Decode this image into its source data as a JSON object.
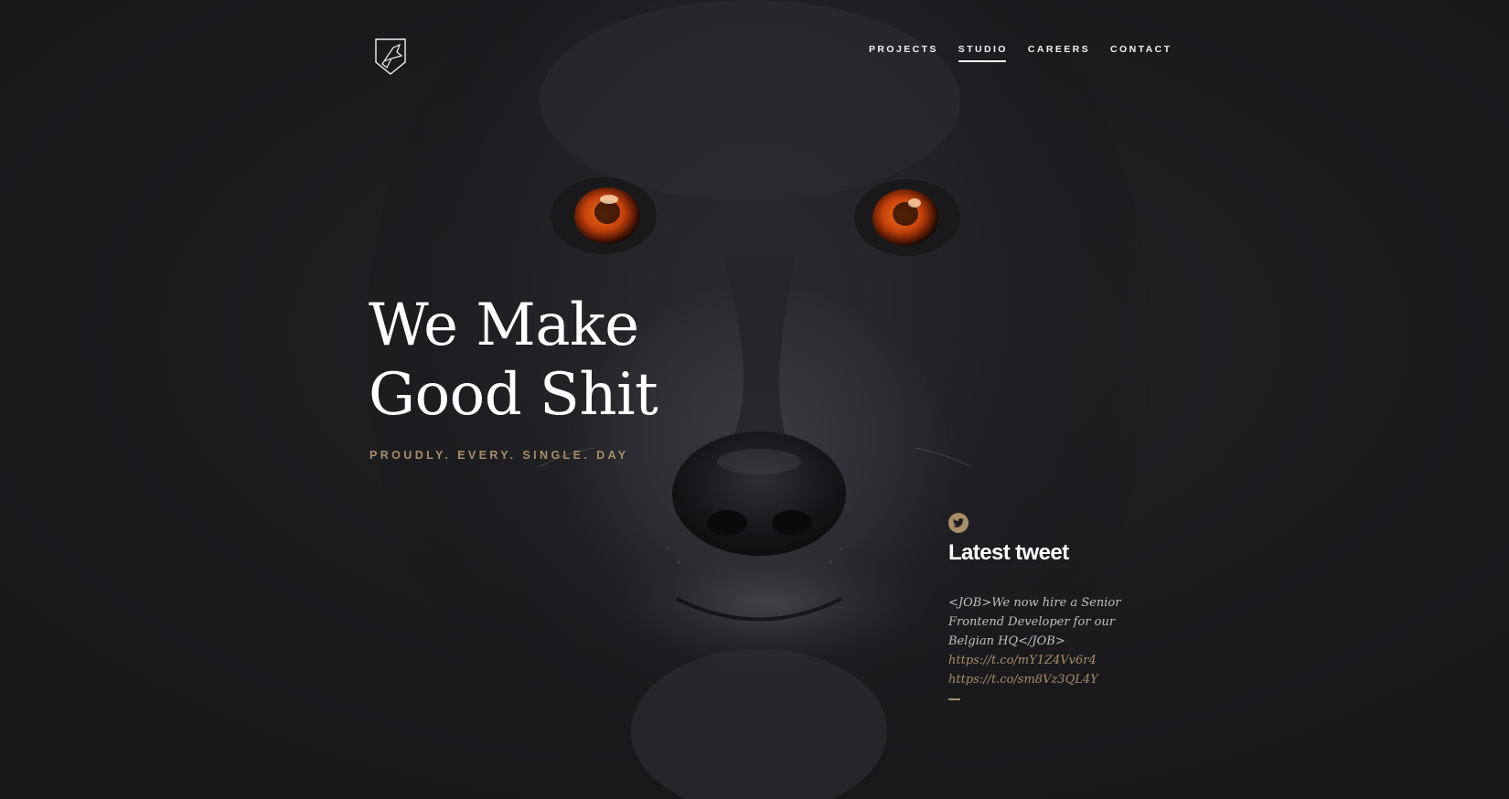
{
  "brand": {
    "logo_icon": "fox-shield-logo-icon"
  },
  "nav": {
    "items": [
      {
        "label": "PROJECTS",
        "active": false
      },
      {
        "label": "STUDIO",
        "active": true
      },
      {
        "label": "CAREERS",
        "active": false
      },
      {
        "label": "CONTACT",
        "active": false
      }
    ]
  },
  "hero": {
    "title_line1": "We Make",
    "title_line2": "Good Shit",
    "subtitle": "PROUDLY. EVERY. SINGLE. DAY"
  },
  "tweet": {
    "icon": "twitter-bird-icon",
    "heading": "Latest tweet",
    "text": "<JOB>We now hire a Senior Frontend Developer for our Belgian HQ</JOB>",
    "links": [
      "https://t.co/mY1Z4Vv6r4",
      "https://t.co/sm8Vz3QL4Y"
    ]
  },
  "colors": {
    "background": "#1c1c1e",
    "accent_gold": "#a88e68",
    "eye_orange": "#c2410c",
    "text_white": "#ffffff"
  }
}
